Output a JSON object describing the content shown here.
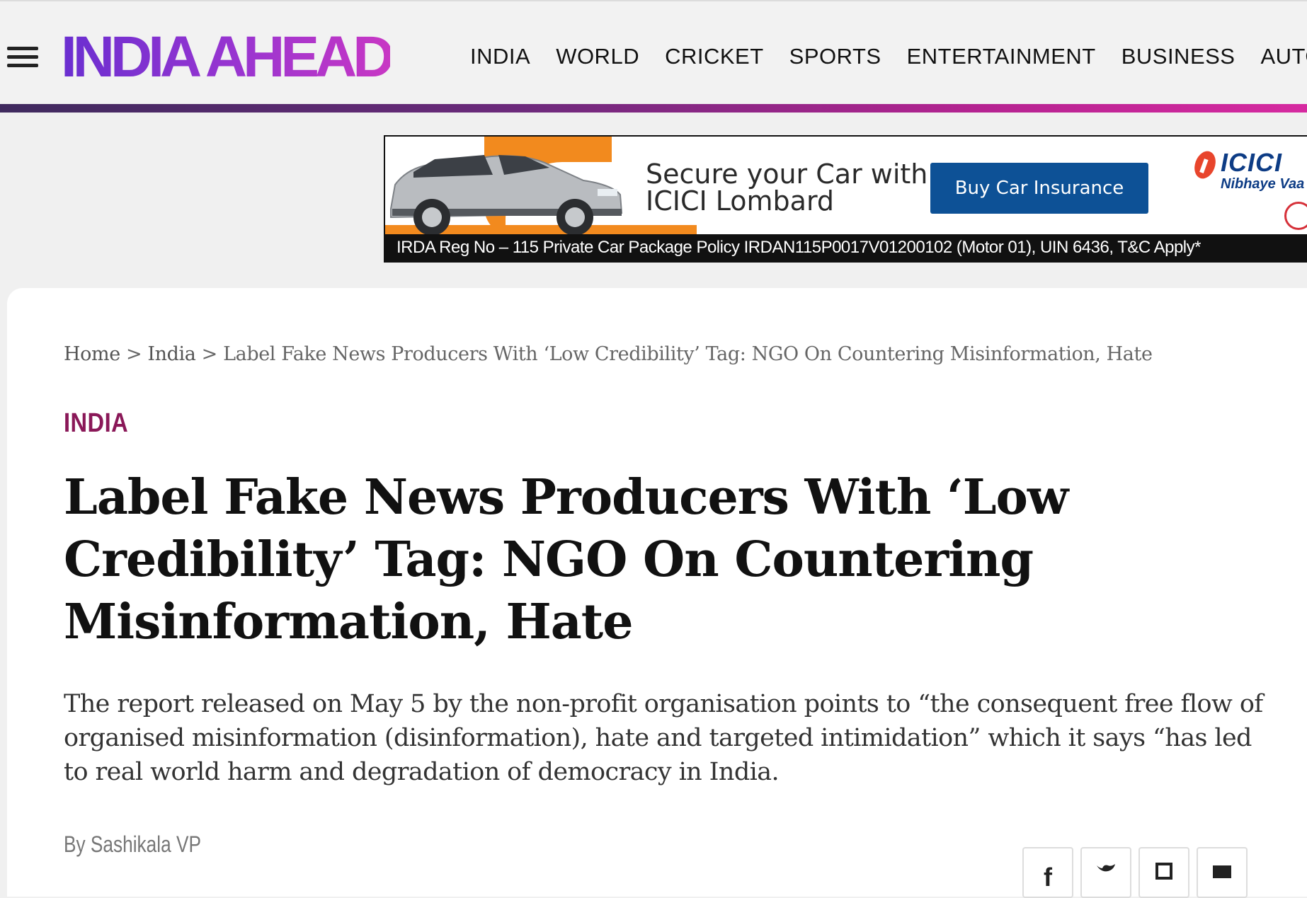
{
  "header": {
    "logo_text": "INDIA AHEAD",
    "nav": [
      "INDIA",
      "WORLD",
      "CRICKET",
      "SPORTS",
      "ENTERTAINMENT",
      "BUSINESS",
      "AUTO"
    ]
  },
  "ad": {
    "headline_line1": "Secure your Car with",
    "headline_line2": "ICICI Lombard",
    "cta": "Buy Car Insurance",
    "brand": "ICICI",
    "brand_tag": "Nibhaye Vaa",
    "footer": "IRDA Reg No – 115 Private Car Package Policy IRDAN115P0017V01200102 (Motor 01), UIN 6436, T&C Apply*"
  },
  "article": {
    "breadcrumb": {
      "home": "Home",
      "sep": ">",
      "section": "India",
      "current": "Label Fake News Producers With ‘Low Credibility’ Tag: NGO On Countering Misinformation, Hate"
    },
    "category": "INDIA",
    "headline": "Label Fake News Producers With ‘Low Credibility’ Tag: NGO On Countering Misinformation, Hate",
    "dek": "The report released on May 5 by the non-profit organisation points to “the consequent free flow of organised misinformation (disinformation), hate and targeted intimidation” which it says “has led to real world harm and degradation of democracy in India.",
    "byline": "By Sashikala VP"
  },
  "share": [
    {
      "icon": "facebook-icon",
      "glyph": "f"
    },
    {
      "icon": "twitter-icon",
      "glyph": "🐦"
    },
    {
      "icon": "bookmark-icon",
      "glyph": "▭"
    },
    {
      "icon": "email-icon",
      "glyph": "✉"
    }
  ],
  "colors": {
    "logo_start": "#6a2fd0",
    "logo_end": "#c837c4",
    "category": "#8a1858",
    "cta": "#0d5196",
    "ad_accent": "#f28a1e"
  }
}
